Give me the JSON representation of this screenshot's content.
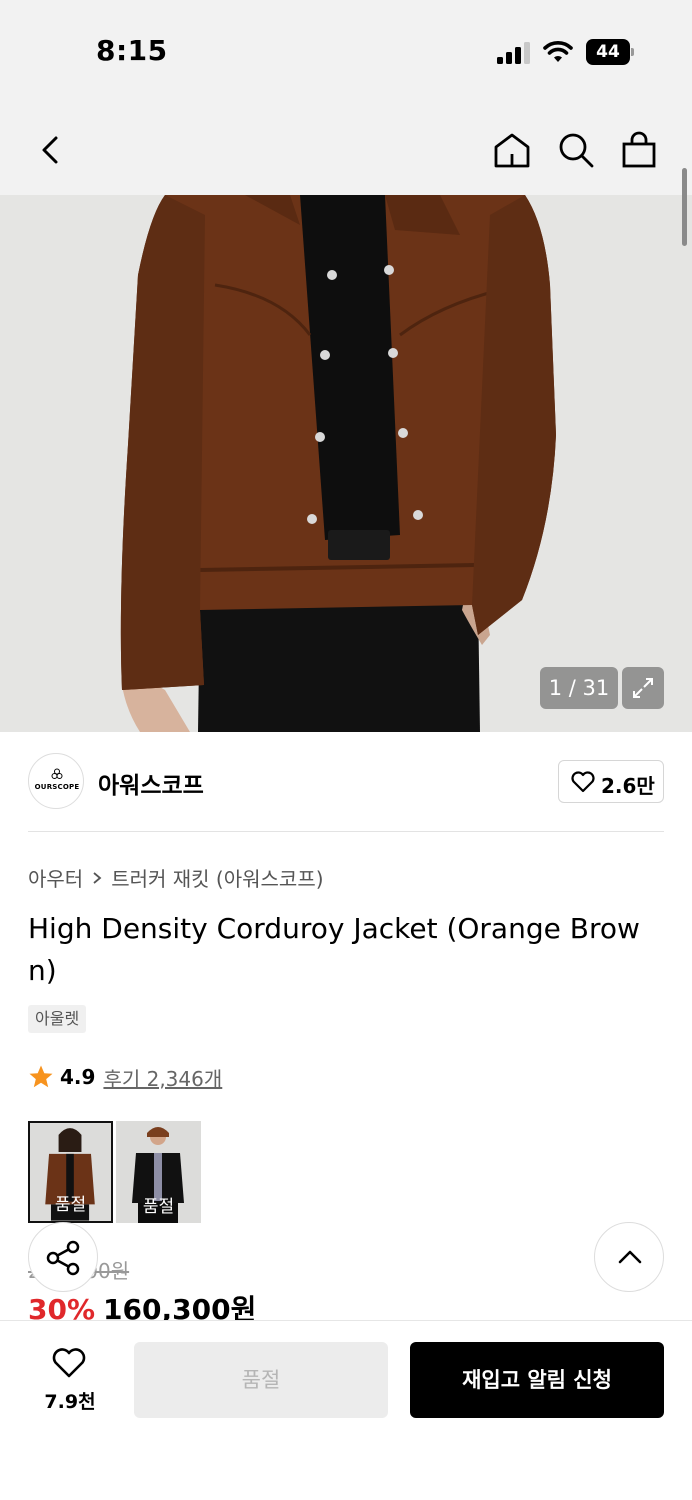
{
  "status_bar": {
    "time": "8:15",
    "battery": "44"
  },
  "nav": {
    "back_icon": "chevron-left-icon",
    "home_icon": "home-icon",
    "search_icon": "search-icon",
    "bag_icon": "shopping-bag-icon"
  },
  "gallery": {
    "counter": "1 / 31",
    "expand_icon": "expand-icon"
  },
  "brand": {
    "logo_text": "OURSCOPE",
    "name": "아워스코프",
    "likes": "2.6만"
  },
  "breadcrumb": {
    "category": "아우터",
    "subcategory": "트러커 재킷 (아워스코프)"
  },
  "product": {
    "title": "High Density Corduroy Jacket (Orange Brown)",
    "badge": "아울렛",
    "rating": "4.9",
    "reviews": "후기 2,346개"
  },
  "swatches": [
    {
      "label": "품절",
      "color": "#6b3317"
    },
    {
      "label": "품절",
      "color": "#111111"
    }
  ],
  "price": {
    "original": "229,000원",
    "discount": "30%",
    "sale": "160,300원"
  },
  "bottom_bar": {
    "wish_count": "7.9천",
    "soldout_label": "품절",
    "restock_label": "재입고 알림 신청"
  },
  "colors": {
    "accent_red": "#e0282b",
    "star": "#f7931e",
    "primary_button": "#000000"
  }
}
